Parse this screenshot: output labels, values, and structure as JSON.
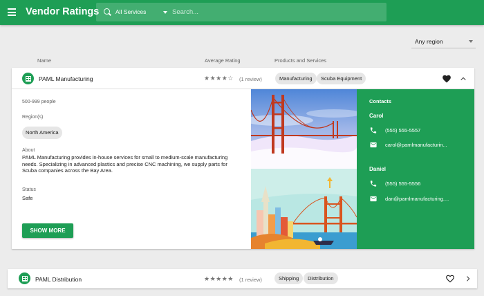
{
  "app": {
    "title": "Vendor Ratings"
  },
  "search": {
    "scope": "All Services",
    "placeholder": "Search..."
  },
  "filter": {
    "region": "Any region"
  },
  "columns": {
    "name": "Name",
    "rating": "Average Rating",
    "products": "Products and Services"
  },
  "vendors": [
    {
      "name": "PAML Manufacturing",
      "rating": 4,
      "stars": "★★★★☆",
      "reviews": "(1 review)",
      "chips": [
        "Manufacturing",
        "Scuba Equipment"
      ],
      "favorite": true,
      "expanded": true,
      "size": "500-999 people",
      "region_label": "Region(s)",
      "region": "North America",
      "about_label": "About",
      "about": "PAML Manufacturing provides in-house services for small to medium-scale manufacturing needs. Specializing in advanced plastics and precise CNC machining, we supply parts for Scuba companies across the Bay Area.",
      "status_label": "Status",
      "status": "Safe",
      "show_more": "SHOW MORE",
      "contacts": {
        "title": "Contacts",
        "people": [
          {
            "name": "Carol",
            "phone": "(555) 555-5557",
            "email": "carol@pamlmanufacturin..."
          },
          {
            "name": "Daniel",
            "phone": "(555) 555-5556",
            "email": "dan@pamlmanufacturing...."
          }
        ]
      }
    },
    {
      "name": "PAML Distribution",
      "rating": 5,
      "stars": "★★★★★",
      "reviews": "(1 review)",
      "chips": [
        "Shipping",
        "Distribution"
      ],
      "favorite": false,
      "expanded": false
    }
  ],
  "colors": {
    "primary": "#1e9e55",
    "background": "#ececec"
  }
}
